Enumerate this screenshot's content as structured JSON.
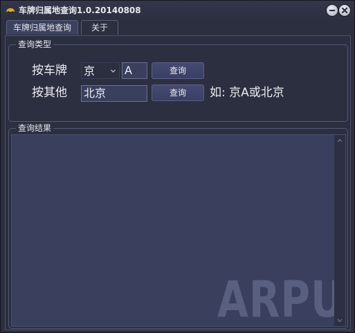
{
  "window": {
    "title": "车牌归属地查询1.0.20140808"
  },
  "tabs": [
    {
      "label": "车牌归属地查询",
      "active": true
    },
    {
      "label": "关于",
      "active": false
    }
  ],
  "query_group": {
    "title": "查询类型",
    "plate_row": {
      "label": "按车牌",
      "province_value": "京",
      "letter_value": "A",
      "button_label": "查询"
    },
    "other_row": {
      "label": "按其他",
      "input_value": "北京",
      "button_label": "查询",
      "hint": "如: 京A或北京"
    }
  },
  "result_group": {
    "title": "查询结果",
    "content": "",
    "watermark": "ARPUN"
  },
  "colors": {
    "background": "#2c2f40",
    "field": "#3a3f5e",
    "button": "#41466c",
    "text": "#ececf2"
  }
}
